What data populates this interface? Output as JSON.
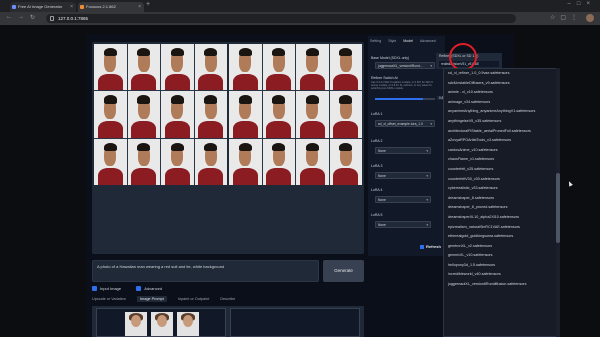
{
  "browser": {
    "tabs": [
      {
        "title": "Free AI Image Generator"
      },
      {
        "title": "Fooocus 2.1.862"
      }
    ],
    "address": "127.0.0.1:7865"
  },
  "gallery": {
    "prompt_text": "A photo of a Hawaiian man wearing a red suit and tie, white background",
    "generate_label": "Generate",
    "input_image_label": "Input Image",
    "advanced_label": "Advanced",
    "lower_tabs": [
      "Upscale or Variation",
      "Image Prompt",
      "Inpaint or Outpaint",
      "Describe"
    ]
  },
  "settings": {
    "tabs": [
      "Setting",
      "Style",
      "Model",
      "Advanced"
    ],
    "base_model_label": "Base Model (SDXL only)",
    "base_model_value": "juggernautXL_version6Rund...",
    "refiner_switch_label": "Refiner Switch At",
    "refiner_note": "Use 0.4 for SD1.5 realistic models; or 0.667 for SD1.5 anime models; or 0.8 for XL-refiners; or any value for switching two SDXL models.",
    "refiner_value": "0.8",
    "lora1_label": "LoRA 1",
    "lora1_value": "sd_xl_offset_example-lora_1.0",
    "lora_labels": [
      "LoRA 2",
      "LoRA 3",
      "LoRA 4",
      "LoRA 5"
    ],
    "lora_none": "None",
    "refresh_label": "Refresh",
    "refiner_head_label": "Refiner (SDXL or SD 1.5)",
    "refiner_head_value": "realisticVisionV51_v51VAE"
  },
  "dropdown_items": [
    "None",
    "dreamshaper_8.safetensors",
    "dreamshaper_8_pruned.safetensors",
    "dreamshaperXL10_alpha2Xl10.safetensors",
    "epicrealism_naturalSinRC1VAE.safetensors",
    "etherealgold_goldkingsuma.safetensors",
    "gemtronXL_v2.safetensors",
    "genmixXL_v10.safetensors",
    "hellopony3d_1.5.safetensors",
    "incredibleworld_v40.safetensors",
    "juggernautXL_version6Rundiffusion.safetensors"
  ],
  "dropdown_top_items": [
    "sd_xl_refiner_1.0_0.9vae.safetensors",
    "sdxlUnstableDiffusers_v9.safetensors",
    "animie - xl_v10.safetensors",
    "animage_v34.safetensors",
    "anyanimeAnything_anyanimeAnythingV1.safetensors",
    "anythingelseV5_v35.safetensors",
    "architecturalFtStable_aerialPrunedFull.safetensors",
    "aZovyaRPGArtistTools_v3.safetensors",
    "cardosAnime_v10.safetensors",
    "chaosFlame_v1.safetensors",
    "counterfeit_v25.safetensors",
    "counterfeitV30_v30.safetensors",
    "cyberrealistic_v33.safetensors"
  ]
}
